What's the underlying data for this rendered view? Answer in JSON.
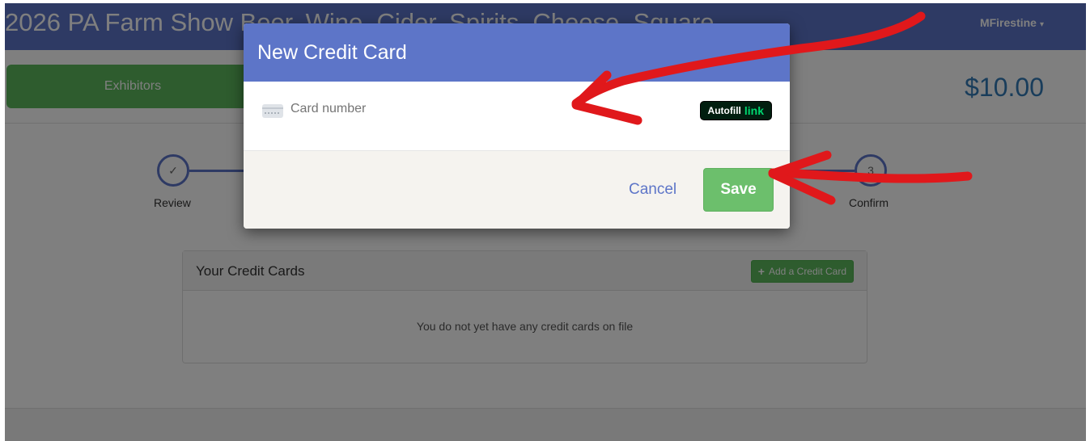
{
  "navbar": {
    "title": "2026 PA Farm Show Beer, Wine, Cider, Spirits, Cheese, Square",
    "user": "MFirestine",
    "user_caret": "▾"
  },
  "subheader": {
    "exhibitors_label": "Exhibitors",
    "balance": "$10.00"
  },
  "steps": [
    {
      "label": "Review",
      "marker": "✓"
    },
    {
      "label": "Confirm",
      "marker": "3"
    }
  ],
  "credit_cards_panel": {
    "title": "Your Credit Cards",
    "add_button_icon": "+",
    "add_button_label": "Add a Credit Card",
    "empty_message": "You do not yet have any credit cards on file"
  },
  "modal": {
    "title": "New Credit Card",
    "card_number_placeholder": "Card number",
    "autofill_text": "Autofill",
    "autofill_link_text": "link",
    "cancel_label": "Cancel",
    "save_label": "Save"
  },
  "colors": {
    "brand_blue": "#5d75c8",
    "success_green": "#5cb85c",
    "annotation_red": "#e0181b",
    "link_green": "#00d66f"
  },
  "icons": {
    "step_check": "check-icon",
    "card": "credit-card-icon",
    "plus": "plus-icon"
  }
}
